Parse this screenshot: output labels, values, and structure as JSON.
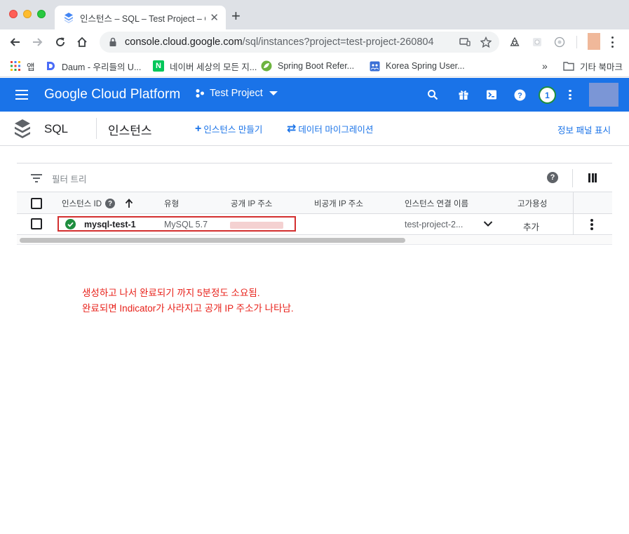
{
  "browser": {
    "tab_title": "인스턴스 – SQL – Test Project – G",
    "tab_close": "✕",
    "new_tab": "+",
    "url_host": "console.cloud.google.com",
    "url_path": "/sql/instances?project=test-project-260804",
    "bookmarks": [
      {
        "label": "앱",
        "icon": "apps-grid-icon"
      },
      {
        "label": "Daum - 우리들의 U...",
        "icon": "daum-icon"
      },
      {
        "label": "네이버 세상의 모든 지...",
        "icon": "naver-icon"
      },
      {
        "label": "Spring Boot Refer...",
        "icon": "spring-icon"
      },
      {
        "label": "Korea Spring User...",
        "icon": "user-group-icon"
      }
    ],
    "bookmarks_more": "»",
    "other_bookmarks": "기타 북마크"
  },
  "gcp_header": {
    "title": "Google Cloud Platform",
    "project": "Test Project",
    "notification_count": "1"
  },
  "subheader": {
    "product": "SQL",
    "page_title": "인스턴스",
    "create_action": "인스턴스 만들기",
    "create_icon": "+",
    "migrate_action": "데이터 마이그레이션",
    "migrate_icon": "⇄",
    "info_panel": "정보 패널 표시"
  },
  "table": {
    "filter_placeholder": "필터 트리",
    "help": "?",
    "columns": [
      "인스턴스 ID",
      "유형",
      "공개 IP 주소",
      "비공개 IP 주소",
      "인스턴스 연결 이름",
      "고가용성"
    ],
    "rows": [
      {
        "status": "running",
        "instance_id": "mysql-test-1",
        "type": "MySQL 5.7",
        "public_ip": "",
        "private_ip": "",
        "connection_name": "test-project-2...",
        "high_availability": "추가"
      }
    ]
  },
  "annotation": {
    "line1": "생성하고 나서 완료되기 까지 5분정도 소요됨.",
    "line2": "완료되면 Indicator가 사라지고 공개 IP 주소가 나타남."
  },
  "colors": {
    "gcp_blue": "#1a73e8",
    "status_green": "#1e8e3e",
    "annotation_red": "#e8211a"
  }
}
